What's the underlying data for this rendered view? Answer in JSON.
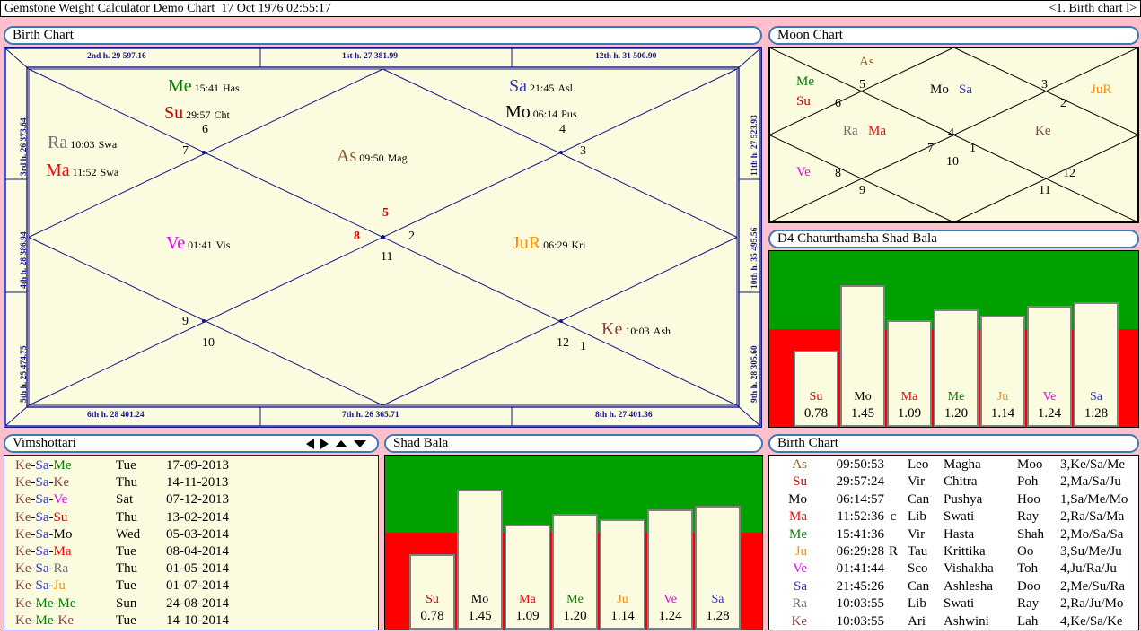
{
  "titlebar": {
    "app_title": "Gemstone Weight Calculator Demo Chart",
    "datetime": "17 Oct 1976 02:55:17",
    "nav": "<1. Birth chart l>"
  },
  "birth_chart": {
    "caption": "Birth Chart",
    "house_labels_top": [
      {
        "text": "2nd h.  29  597.16"
      },
      {
        "text": "1st h.  27  381.99"
      },
      {
        "text": "12th h.  31  500.90"
      }
    ],
    "house_labels_left": [
      {
        "text": "3rd h.  26  373.64"
      },
      {
        "text": "4th h.  28  386.94"
      },
      {
        "text": "5th h.  25  474.75"
      }
    ],
    "house_labels_bottom": [
      {
        "text": "6th h.  28  401.24"
      },
      {
        "text": "7th h.  26  365.71"
      },
      {
        "text": "8th h.  27  401.36"
      }
    ],
    "house_labels_right": [
      {
        "text": "11th h.  27  523.93"
      },
      {
        "text": "10th h.  35  495.56"
      },
      {
        "text": "9th h.  28  305.60"
      }
    ],
    "planets": [
      {
        "ab": "Me",
        "deg": "15:41",
        "nak": "Has",
        "color": "#008000"
      },
      {
        "ab": "Su",
        "deg": "29:57",
        "nak": "Cht",
        "color": "#cc0000"
      },
      {
        "ab": "Ra",
        "deg": "10:03",
        "nak": "Swa",
        "color": "#707070"
      },
      {
        "ab": "Ma",
        "deg": "11:52",
        "nak": "Swa",
        "color": "#ff0000"
      },
      {
        "ab": "Ve",
        "deg": "01:41",
        "nak": "Vis",
        "color": "#ee00ee"
      },
      {
        "ab": "As",
        "deg": "09:50",
        "nak": "Mag",
        "color": "#8b5a2b"
      },
      {
        "ab": "Sa",
        "deg": "21:45",
        "nak": "Asl",
        "color": "#3333cc"
      },
      {
        "ab": "Mo",
        "deg": "06:14",
        "nak": "Pus",
        "color": "#000000"
      },
      {
        "ab": "JuR",
        "deg": "06:29",
        "nak": "Kri",
        "color": "#ff8c00"
      },
      {
        "ab": "Ke",
        "deg": "10:03",
        "nak": "Ash",
        "color": "#8b4040"
      }
    ],
    "house_numbers": [
      "1",
      "2",
      "3",
      "4",
      "5",
      "6",
      "7",
      "8",
      "9",
      "10",
      "11",
      "12"
    ]
  },
  "moon_chart": {
    "caption": "Moon Chart",
    "items": [
      {
        "text": "As",
        "color": "#8b5a2b"
      },
      {
        "text": "Me",
        "color": "#008000"
      },
      {
        "text": "Su",
        "color": "#cc0000"
      },
      {
        "text": "Mo",
        "color": "#000000"
      },
      {
        "text": "Sa",
        "color": "#3333cc"
      },
      {
        "text": "JuR",
        "color": "#ff8c00"
      },
      {
        "text": "Ra",
        "color": "#707070"
      },
      {
        "text": "Ma",
        "color": "#ff0000"
      },
      {
        "text": "Ke",
        "color": "#8b4040"
      },
      {
        "text": "Ve",
        "color": "#ee00ee"
      }
    ],
    "numbers": [
      "1",
      "2",
      "3",
      "4",
      "5",
      "6",
      "7",
      "8",
      "9",
      "10",
      "11",
      "12"
    ]
  },
  "d4_panel": {
    "caption": "D4 Chaturthamsha  Shad Bala"
  },
  "shad_bala_panel": {
    "caption": "Shad Bala"
  },
  "vimshottari": {
    "caption": "Vimshottari",
    "arrows": [
      "left-arrow",
      "right-arrow",
      "up-arrow",
      "down-arrow"
    ],
    "rows": [
      {
        "p1": "Ke",
        "p2": "Sa",
        "p3": "Me",
        "c1": "#8b4040",
        "c2": "#3333cc",
        "c3": "#008000",
        "day": "Tue",
        "date": "17-09-2013"
      },
      {
        "p1": "Ke",
        "p2": "Sa",
        "p3": "Ke",
        "c1": "#8b4040",
        "c2": "#3333cc",
        "c3": "#8b4040",
        "day": "Thu",
        "date": "14-11-2013"
      },
      {
        "p1": "Ke",
        "p2": "Sa",
        "p3": "Ve",
        "c1": "#8b4040",
        "c2": "#3333cc",
        "c3": "#ee00ee",
        "day": "Sat",
        "date": "07-12-2013"
      },
      {
        "p1": "Ke",
        "p2": "Sa",
        "p3": "Su",
        "c1": "#8b4040",
        "c2": "#3333cc",
        "c3": "#cc0000",
        "day": "Thu",
        "date": "13-02-2014"
      },
      {
        "p1": "Ke",
        "p2": "Sa",
        "p3": "Mo",
        "c1": "#8b4040",
        "c2": "#3333cc",
        "c3": "#000000",
        "day": "Wed",
        "date": "05-03-2014"
      },
      {
        "p1": "Ke",
        "p2": "Sa",
        "p3": "Ma",
        "c1": "#8b4040",
        "c2": "#3333cc",
        "c3": "#ff0000",
        "day": "Tue",
        "date": "08-04-2014"
      },
      {
        "p1": "Ke",
        "p2": "Sa",
        "p3": "Ra",
        "c1": "#8b4040",
        "c2": "#3333cc",
        "c3": "#707070",
        "day": "Thu",
        "date": "01-05-2014"
      },
      {
        "p1": "Ke",
        "p2": "Sa",
        "p3": "Ju",
        "c1": "#8b4040",
        "c2": "#3333cc",
        "c3": "#ff8c00",
        "day": "Tue",
        "date": "01-07-2014"
      },
      {
        "p1": "Ke",
        "p2": "Me",
        "p3": "Me",
        "c1": "#8b4040",
        "c2": "#008000",
        "c3": "#008000",
        "day": "Sun",
        "date": "24-08-2014"
      },
      {
        "p1": "Ke",
        "p2": "Me",
        "p3": "Ke",
        "c1": "#8b4040",
        "c2": "#008000",
        "c3": "#8b4040",
        "day": "Tue",
        "date": "14-10-2014"
      }
    ]
  },
  "birth_table": {
    "caption": "Birth Chart",
    "rows": [
      {
        "pl": "As",
        "color": "#8b5a2b",
        "deg": "09:50:53",
        "rx": "",
        "sign": "Leo",
        "nak": "Magha",
        "x": "Moo",
        "sub": "3,Ke/Sa/Me"
      },
      {
        "pl": "Su",
        "color": "#cc0000",
        "deg": "29:57:24",
        "rx": "",
        "sign": "Vir",
        "nak": "Chitra",
        "x": "Poh",
        "sub": "2,Ma/Sa/Ju"
      },
      {
        "pl": "Mo",
        "color": "#000000",
        "deg": "06:14:57",
        "rx": "",
        "sign": "Can",
        "nak": "Pushya",
        "x": "Hoo",
        "sub": "1,Sa/Me/Mo"
      },
      {
        "pl": "Ma",
        "color": "#ff0000",
        "deg": "11:52:36",
        "rx": "c",
        "sign": "Lib",
        "nak": "Swati",
        "x": "Ray",
        "sub": "2,Ra/Sa/Ma"
      },
      {
        "pl": "Me",
        "color": "#008000",
        "deg": "15:41:36",
        "rx": "",
        "sign": "Vir",
        "nak": "Hasta",
        "x": "Shah",
        "sub": "2,Mo/Sa/Sa"
      },
      {
        "pl": "Ju",
        "color": "#ff8c00",
        "deg": "06:29:28",
        "rx": "R",
        "sign": "Tau",
        "nak": "Krittika",
        "x": "Oo",
        "sub": "3,Su/Me/Ju"
      },
      {
        "pl": "Ve",
        "color": "#ee00ee",
        "deg": "01:41:44",
        "rx": "",
        "sign": "Sco",
        "nak": "Vishakha",
        "x": "Toh",
        "sub": "4,Ju/Ra/Ju"
      },
      {
        "pl": "Sa",
        "color": "#3333cc",
        "deg": "21:45:26",
        "rx": "",
        "sign": "Can",
        "nak": "Ashlesha",
        "x": "Doo",
        "sub": "2,Me/Su/Ra"
      },
      {
        "pl": "Ra",
        "color": "#707070",
        "deg": "10:03:55",
        "rx": "",
        "sign": "Lib",
        "nak": "Swati",
        "x": "Ray",
        "sub": "2,Ra/Ju/Mo"
      },
      {
        "pl": "Ke",
        "color": "#8b4040",
        "deg": "10:03:55",
        "rx": "",
        "sign": "Ari",
        "nak": "Ashwini",
        "x": "Lah",
        "sub": "4,Ke/Sa/Ke"
      }
    ]
  },
  "chart_data": [
    {
      "type": "bar",
      "title": "D4 Chaturthamsha  Shad Bala",
      "categories": [
        "Su",
        "Mo",
        "Ma",
        "Me",
        "Ju",
        "Ve",
        "Sa"
      ],
      "values": [
        0.78,
        1.45,
        1.09,
        1.2,
        1.14,
        1.24,
        1.28
      ],
      "category_colors": [
        "#cc0000",
        "#000000",
        "#ff0000",
        "#008000",
        "#ff8c00",
        "#ee00ee",
        "#3333cc"
      ],
      "xlabel": "",
      "ylabel": "",
      "ylim": [
        0,
        1.8
      ],
      "threshold": 1.0,
      "below_threshold_color": "#ff0000",
      "above_threshold_color": "#00a000",
      "bar_fill": "#fbfbe0",
      "grid": false,
      "legend": "none"
    },
    {
      "type": "bar",
      "title": "Shad Bala",
      "categories": [
        "Su",
        "Mo",
        "Ma",
        "Me",
        "Ju",
        "Ve",
        "Sa"
      ],
      "values": [
        0.78,
        1.45,
        1.09,
        1.2,
        1.14,
        1.24,
        1.28
      ],
      "category_colors": [
        "#cc0000",
        "#000000",
        "#ff0000",
        "#008000",
        "#ff8c00",
        "#ee00ee",
        "#3333cc"
      ],
      "xlabel": "",
      "ylabel": "",
      "ylim": [
        0,
        1.8
      ],
      "threshold": 1.0,
      "below_threshold_color": "#ff0000",
      "above_threshold_color": "#00a000",
      "bar_fill": "#fbfbe0",
      "grid": false,
      "legend": "none"
    }
  ]
}
